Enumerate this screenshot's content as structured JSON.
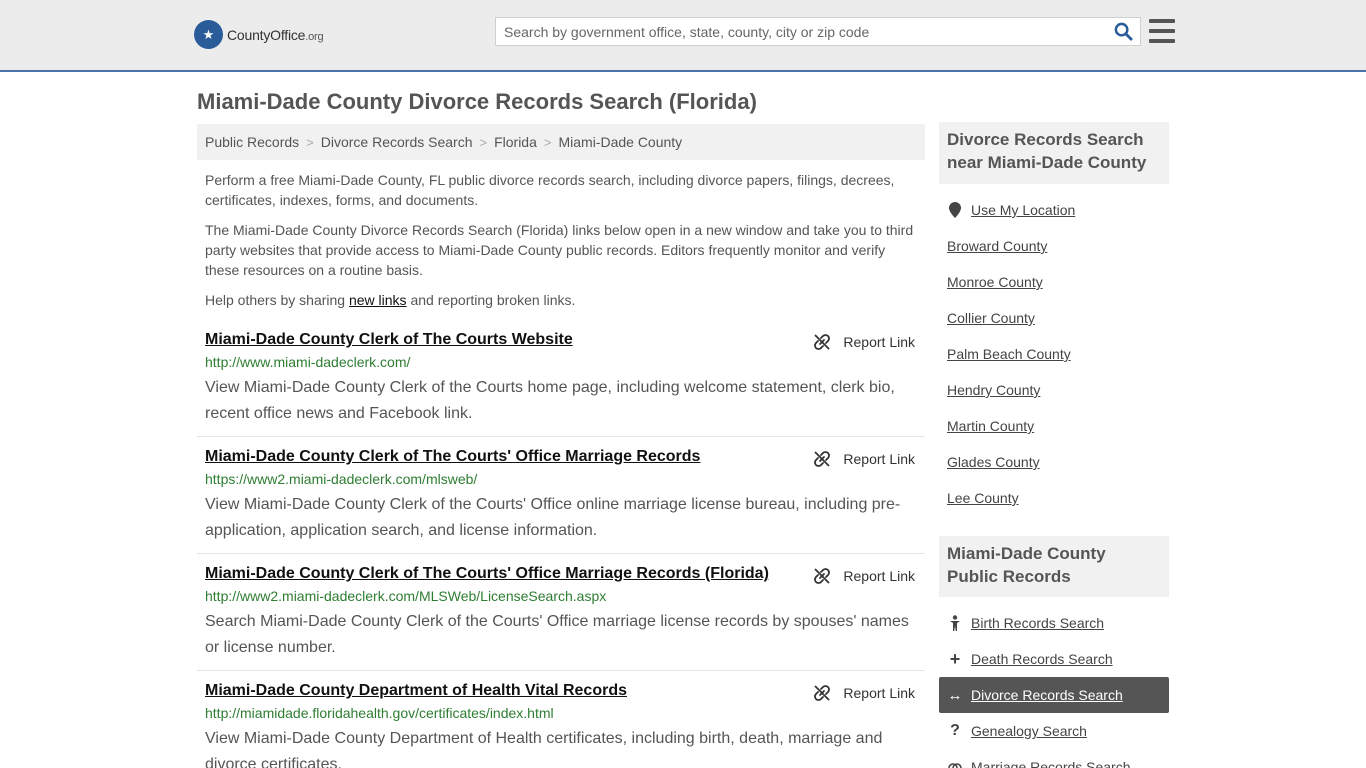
{
  "header": {
    "logo_text": "CountyOffice",
    "logo_suffix": ".org",
    "search_placeholder": "Search by government office, state, county, city or zip code"
  },
  "page": {
    "title": "Miami-Dade County Divorce Records Search (Florida)"
  },
  "breadcrumb": [
    "Public Records",
    "Divorce Records Search",
    "Florida",
    "Miami-Dade County"
  ],
  "intro": {
    "p1": "Perform a free Miami-Dade County, FL public divorce records search, including divorce papers, filings, decrees, certificates, indexes, forms, and documents.",
    "p2": "The Miami-Dade County Divorce Records Search (Florida) links below open in a new window and take you to third party websites that provide access to Miami-Dade County public records. Editors frequently monitor and verify these resources on a routine basis.",
    "p3_before": "Help others by sharing ",
    "p3_link": "new links",
    "p3_after": " and reporting broken links."
  },
  "report_label": "Report Link",
  "results": [
    {
      "title": "Miami-Dade County Clerk of The Courts Website",
      "url": "http://www.miami-dadeclerk.com/",
      "desc": "View Miami-Dade County Clerk of the Courts home page, including welcome statement, clerk bio, recent office news and Facebook link."
    },
    {
      "title": "Miami-Dade County Clerk of The Courts' Office Marriage Records",
      "url": "https://www2.miami-dadeclerk.com/mlsweb/",
      "desc": "View Miami-Dade County Clerk of the Courts' Office online marriage license bureau, including pre-application, application search, and license information."
    },
    {
      "title": "Miami-Dade County Clerk of The Courts' Office Marriage Records (Florida)",
      "url": "http://www2.miami-dadeclerk.com/MLSWeb/LicenseSearch.aspx",
      "desc": "Search Miami-Dade County Clerk of the Courts' Office marriage license records by spouses' names or license number."
    },
    {
      "title": "Miami-Dade County Department of Health Vital Records",
      "url": "http://miamidade.floridahealth.gov/certificates/index.html",
      "desc": "View Miami-Dade County Department of Health certificates, including birth, death, marriage and divorce certificates."
    }
  ],
  "sidebar": {
    "nearby_heading": "Divorce Records Search near Miami-Dade County",
    "use_location": "Use My Location",
    "nearby": [
      "Broward County",
      "Monroe County",
      "Collier County",
      "Palm Beach County",
      "Hendry County",
      "Martin County",
      "Glades County",
      "Lee County"
    ],
    "public_heading": "Miami-Dade County Public Records",
    "public_records": [
      {
        "label": "Birth Records Search",
        "icon": "person-icon"
      },
      {
        "label": "Death Records Search",
        "icon": "plus-icon"
      },
      {
        "label": "Divorce Records Search",
        "icon": "arrows-horizontal-icon"
      },
      {
        "label": "Genealogy Search",
        "icon": "question-icon"
      },
      {
        "label": "Marriage Records Search",
        "icon": "rings-icon"
      }
    ],
    "active_color": "#555555"
  }
}
